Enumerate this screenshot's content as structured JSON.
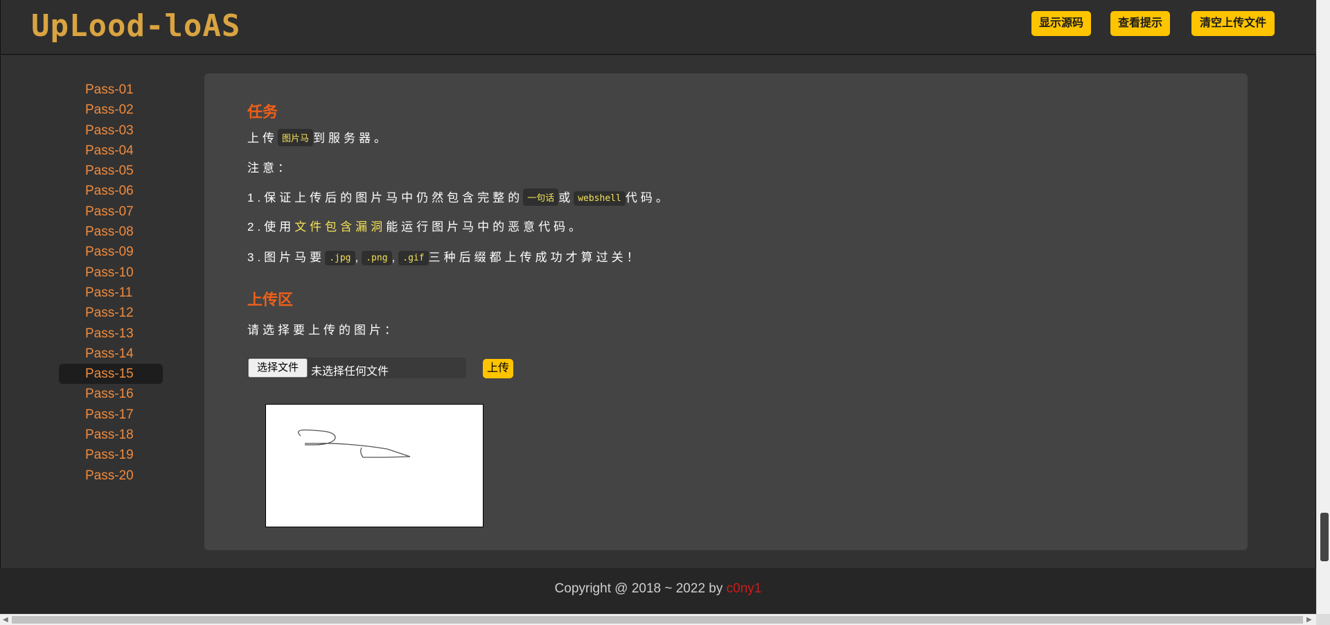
{
  "header": {
    "logo_text": "UpLood-loAS",
    "buttons": [
      "显示源码",
      "查看提示",
      "清空上传文件"
    ]
  },
  "sidebar": {
    "items": [
      "Pass-01",
      "Pass-02",
      "Pass-03",
      "Pass-04",
      "Pass-05",
      "Pass-06",
      "Pass-07",
      "Pass-08",
      "Pass-09",
      "Pass-10",
      "Pass-11",
      "Pass-12",
      "Pass-13",
      "Pass-14",
      "Pass-15",
      "Pass-16",
      "Pass-17",
      "Pass-18",
      "Pass-19",
      "Pass-20"
    ],
    "active": "Pass-15"
  },
  "task": {
    "title": "任务",
    "line1": {
      "pre": "上传",
      "code": "图片马",
      "post": "到服务器。"
    },
    "note": "注意：",
    "item1": {
      "pre": "1.保证上传后的图片马中仍然包含完整的",
      "code1": "一句话",
      "mid": "或",
      "code2": "webshell",
      "post": "代码。"
    },
    "item2": {
      "pre": "2.使用",
      "highlight": "文件包含漏洞",
      "post": "能运行图片马中的恶意代码。"
    },
    "item3": {
      "pre": "3.图片马要",
      "code1": ".jpg",
      "sep1": ",",
      "code2": ".png",
      "sep2": ",",
      "code3": ".gif",
      "post": "三种后缀都上传成功才算过关！"
    }
  },
  "upload": {
    "title": "上传区",
    "prompt": "请选择要上传的图片：",
    "choose_label": "选择文件",
    "no_file_text": "未选择任何文件",
    "submit_label": "上传"
  },
  "footer": {
    "text": "Copyright @ 2018 ~ 2022 by",
    "author": "c0ny1"
  },
  "colors": {
    "accent": "#ffc400",
    "heading": "#ef6019",
    "nav": "#f08b3e",
    "code": "#f4e257",
    "author": "#d11a1a"
  }
}
